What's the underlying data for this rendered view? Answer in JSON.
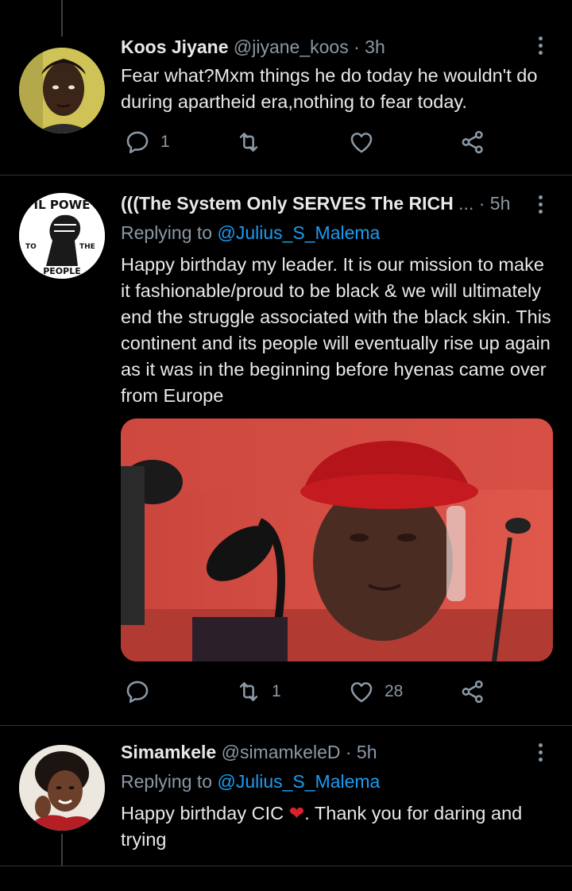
{
  "tweets": [
    {
      "name": "Koos Jiyane",
      "handle": "@jiyane_koos",
      "time": "3h",
      "text": "Fear what?Mxm things he do today he wouldn't do during apartheid era,nothing to fear today.",
      "replies": "1",
      "retweets": "",
      "likes": ""
    },
    {
      "name": "(((The System Only SERVES The RICH",
      "ellipsis": "...",
      "time": "5h",
      "replying_prefix": "Replying to",
      "replying_to": "@Julius_S_Malema",
      "text": "Happy birthday my leader. It is our mission to make it fashionable/proud to be black & we will ultimately end the struggle associated with the black skin. This continent and its people will eventually rise up again as it was in the beginning before hyenas came over from Europe",
      "avatar_text_top": "IL POWE",
      "avatar_text_left": "TO",
      "avatar_text_right": "THE",
      "avatar_text_bottom": "PEOPLE",
      "replies": "",
      "retweets": "1",
      "likes": "28"
    },
    {
      "name": "Simamkele",
      "handle": "@simamkeleD",
      "time": "5h",
      "replying_prefix": "Replying to",
      "replying_to": "@Julius_S_Malema",
      "text_before": "Happy birthday CIC ",
      "emoji": "❤️",
      "text_after": ". Thank you for daring and trying"
    }
  ],
  "separator": "·",
  "colors": {
    "background": "#000000",
    "link": "#1d9bf0",
    "secondary": "#8b98a5",
    "primary_text": "#e7e9ea"
  },
  "icons": [
    "reply-icon",
    "retweet-icon",
    "like-icon",
    "share-icon",
    "more-icon"
  ]
}
